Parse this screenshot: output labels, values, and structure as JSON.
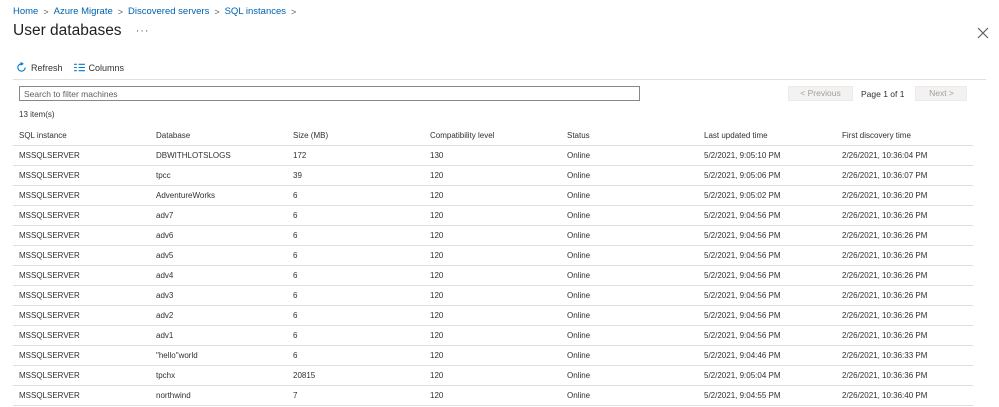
{
  "breadcrumb": [
    "Home",
    "Azure Migrate",
    "Discovered servers",
    "SQL instances"
  ],
  "breadcrumb_separator": ">",
  "page": {
    "title": "User databases",
    "more": "···"
  },
  "toolbar": {
    "refresh_label": "Refresh",
    "columns_label": "Columns"
  },
  "search": {
    "placeholder": "Search to filter machines",
    "value": ""
  },
  "pager": {
    "previous": "< Previous",
    "page_text": "Page 1 of 1",
    "next": "Next >"
  },
  "item_count": "13 item(s)",
  "table": {
    "columns": [
      "SQL instance",
      "Database",
      "Size (MB)",
      "Compatibility level",
      "Status",
      "Last updated time",
      "First discovery time"
    ],
    "rows": [
      [
        "MSSQLSERVER",
        "DBWITHLOTSLOGS",
        "172",
        "130",
        "Online",
        "5/2/2021, 9:05:10 PM",
        "2/26/2021, 10:36:04 PM"
      ],
      [
        "MSSQLSERVER",
        "tpcc",
        "39",
        "120",
        "Online",
        "5/2/2021, 9:05:06 PM",
        "2/26/2021, 10:36:07 PM"
      ],
      [
        "MSSQLSERVER",
        "AdventureWorks",
        "6",
        "120",
        "Online",
        "5/2/2021, 9:05:02 PM",
        "2/26/2021, 10:36:20 PM"
      ],
      [
        "MSSQLSERVER",
        "adv7",
        "6",
        "120",
        "Online",
        "5/2/2021, 9:04:56 PM",
        "2/26/2021, 10:36:26 PM"
      ],
      [
        "MSSQLSERVER",
        "adv6",
        "6",
        "120",
        "Online",
        "5/2/2021, 9:04:56 PM",
        "2/26/2021, 10:36:26 PM"
      ],
      [
        "MSSQLSERVER",
        "adv5",
        "6",
        "120",
        "Online",
        "5/2/2021, 9:04:56 PM",
        "2/26/2021, 10:36:26 PM"
      ],
      [
        "MSSQLSERVER",
        "adv4",
        "6",
        "120",
        "Online",
        "5/2/2021, 9:04:56 PM",
        "2/26/2021, 10:36:26 PM"
      ],
      [
        "MSSQLSERVER",
        "adv3",
        "6",
        "120",
        "Online",
        "5/2/2021, 9:04:56 PM",
        "2/26/2021, 10:36:26 PM"
      ],
      [
        "MSSQLSERVER",
        "adv2",
        "6",
        "120",
        "Online",
        "5/2/2021, 9:04:56 PM",
        "2/26/2021, 10:36:26 PM"
      ],
      [
        "MSSQLSERVER",
        "adv1",
        "6",
        "120",
        "Online",
        "5/2/2021, 9:04:56 PM",
        "2/26/2021, 10:36:26 PM"
      ],
      [
        "MSSQLSERVER",
        "\"hello\"world",
        "6",
        "120",
        "Online",
        "5/2/2021, 9:04:46 PM",
        "2/26/2021, 10:36:33 PM"
      ],
      [
        "MSSQLSERVER",
        "tpchx",
        "20815",
        "120",
        "Online",
        "5/2/2021, 9:05:04 PM",
        "2/26/2021, 10:36:36 PM"
      ],
      [
        "MSSQLSERVER",
        "northwind",
        "7",
        "120",
        "Online",
        "5/2/2021, 9:04:55 PM",
        "2/26/2021, 10:36:40 PM"
      ]
    ]
  },
  "icons": {
    "refresh": "refresh-icon",
    "columns": "columns-icon",
    "close": "close-icon"
  },
  "colors": {
    "link": "#0062ad",
    "accent": "#0078d4"
  }
}
